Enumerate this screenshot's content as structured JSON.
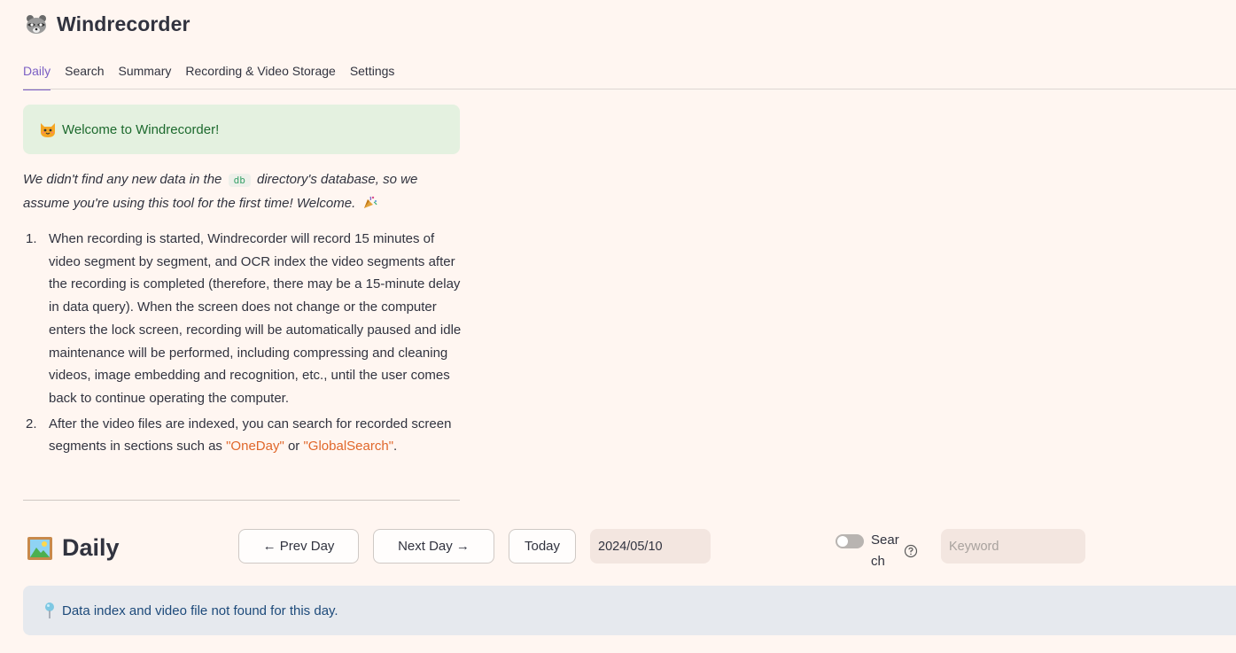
{
  "app": {
    "title": "Windrecorder",
    "logo_icon": "raccoon-icon"
  },
  "tabs": [
    {
      "label": "Daily",
      "active": true
    },
    {
      "label": "Search",
      "active": false
    },
    {
      "label": "Summary",
      "active": false
    },
    {
      "label": "Recording & Video Storage",
      "active": false
    },
    {
      "label": "Settings",
      "active": false
    }
  ],
  "welcome": {
    "icon": "cat-face-icon",
    "text": "Welcome to Windrecorder!"
  },
  "intro": {
    "before_code": "We didn't find any new data in the ",
    "code": "db",
    "after_code": " directory's database, so we assume you're using this tool for the first time! Welcome.",
    "icon": "party-popper-icon"
  },
  "steps": [
    {
      "num": "1.",
      "text": "When recording is started, Windrecorder will record 15 minutes of video segment by segment, and OCR index the video segments after the recording is completed (therefore, there may be a 15-minute delay in data query). When the screen does not change or the computer enters the lock screen, recording will be automatically paused and idle maintenance will be performed, including compressing and cleaning videos, image embedding and recognition, etc., until the user comes back to continue operating the computer."
    },
    {
      "num": "2.",
      "text_before": "After the video files are indexed, you can search for recorded screen segments in sections such as ",
      "hl1": "\"OneDay\"",
      "text_mid": " or ",
      "hl2": "\"GlobalSearch\"",
      "text_after": "."
    }
  ],
  "daily": {
    "icon": "framed-picture-icon",
    "title": "Daily",
    "prev_label": "← Prev Day",
    "next_label": "Next Day →",
    "today_label": "Today",
    "date_value": "2024/05/10",
    "search_toggle_label": "Search",
    "search_toggle_on": false,
    "keyword_placeholder": "Keyword",
    "keyword_value": ""
  },
  "info": {
    "icon": "round-pushpin-icon",
    "text": "Data index and video file not found for this day."
  },
  "colors": {
    "background": "#fff6f1",
    "accent": "#7b5fc4",
    "success_bg": "#e4f1e0",
    "success_text": "#1d6a2e",
    "info_bg": "#e6e9ee",
    "info_text": "#1d4a7a",
    "highlight": "#e0672b"
  }
}
